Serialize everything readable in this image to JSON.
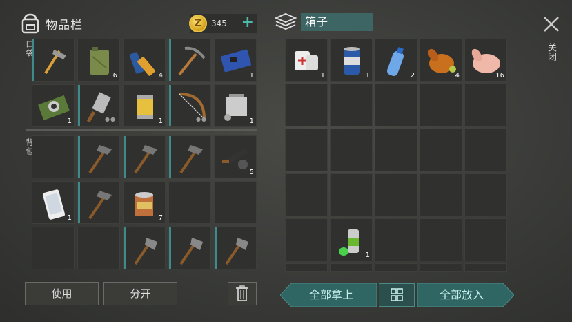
{
  "inventory": {
    "title": "物品栏",
    "coins": "345",
    "pocket_label": "口袋",
    "backpack_label": "背包"
  },
  "container": {
    "title": "箱子"
  },
  "close_label": "关闭",
  "actions": {
    "use": "使用",
    "split": "分开",
    "take_all": "全部拿上",
    "put_all": "全部放入"
  },
  "pocket_slots": [
    {
      "item": "hammer",
      "count": "",
      "durability": true
    },
    {
      "item": "jerrycan",
      "count": "6",
      "durability": false
    },
    {
      "item": "batteries",
      "count": "4",
      "durability": false
    },
    {
      "item": "pickaxe",
      "count": "",
      "durability": true
    },
    {
      "item": "circuit-board",
      "count": "1",
      "durability": false
    },
    {
      "item": "camera-module",
      "count": "1",
      "durability": false
    },
    {
      "item": "cleaver",
      "count": "",
      "durability": true,
      "dots": true
    },
    {
      "item": "oil-filter",
      "count": "1",
      "durability": false
    },
    {
      "item": "bow",
      "count": "",
      "durability": true,
      "dots": true
    },
    {
      "item": "engine-part",
      "count": "1",
      "durability": false
    }
  ],
  "backpack_slots": [
    {
      "item": "",
      "count": ""
    },
    {
      "item": "stone-pickaxe",
      "count": "",
      "durability": true
    },
    {
      "item": "stone-pickaxe",
      "count": "",
      "durability": true
    },
    {
      "item": "stone-pickaxe",
      "count": "",
      "durability": true
    },
    {
      "item": "scope-parts",
      "count": "5"
    },
    {
      "item": "smartphone",
      "count": "1"
    },
    {
      "item": "stone-pickaxe",
      "count": "",
      "durability": true
    },
    {
      "item": "tin-can",
      "count": "7"
    },
    {
      "item": "",
      "count": ""
    },
    {
      "item": "",
      "count": ""
    },
    {
      "item": "",
      "count": ""
    },
    {
      "item": "",
      "count": ""
    },
    {
      "item": "hatchet",
      "count": "",
      "durability": true
    },
    {
      "item": "hatchet",
      "count": "",
      "durability": true
    },
    {
      "item": "hatchet",
      "count": "",
      "durability": true
    }
  ],
  "box_slots": [
    {
      "item": "bandage",
      "count": "1"
    },
    {
      "item": "beer-can",
      "count": "1"
    },
    {
      "item": "water-bottle",
      "count": "2"
    },
    {
      "item": "roast-chicken",
      "count": "4"
    },
    {
      "item": "raw-chicken",
      "count": "16"
    },
    {
      "item": "spray-paint",
      "count": "1"
    }
  ],
  "colors": {
    "accent": "#3f8b8b",
    "button_teal": "#2f6563",
    "coin": "#e9c24a"
  }
}
